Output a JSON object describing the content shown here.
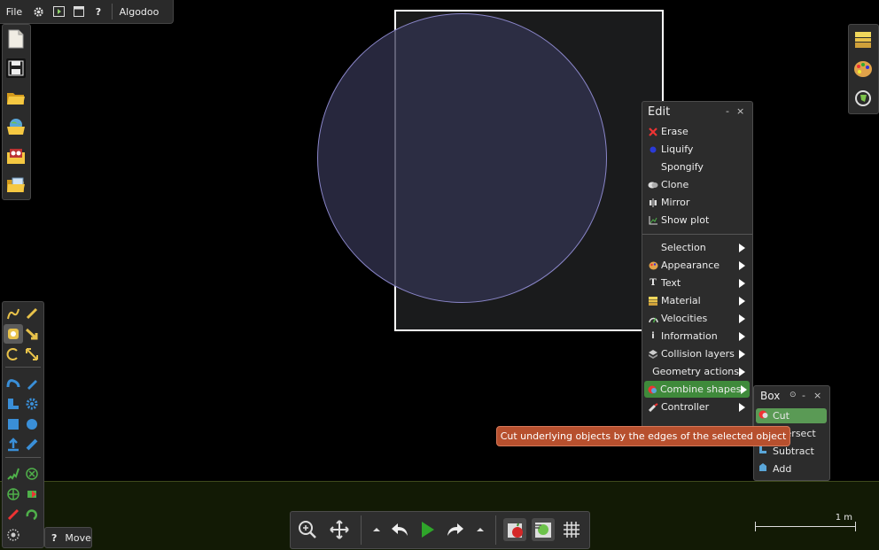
{
  "topbar": {
    "file_label": "File",
    "app_name": "Algodoo",
    "help_label": "?"
  },
  "left_file_panel": {
    "items": [
      "new-scene-icon",
      "save-icon",
      "open-folder-icon",
      "browse-online-icon",
      "load-scenes-icon",
      "open-phunlet-icon"
    ]
  },
  "right_panel": {
    "items": [
      "background-icon",
      "palette-icon",
      "tools-settings-icon"
    ]
  },
  "tools_panel": {
    "tools": [
      "sketch-tool",
      "cut-tool",
      "move-tool",
      "drag-tool",
      "rotate-tool",
      "scale-tool",
      "rope-tool",
      "pencil-tool",
      "plane-tool",
      "gear-tool",
      "box-tool",
      "circle-tool",
      "fixate-tool",
      "spring-tool",
      "chain-tool",
      "hinge-tool",
      "axle-tool",
      "tracer-tool",
      "laser-tool",
      "thruster-tool",
      "brush-tool"
    ]
  },
  "move_hint": {
    "help": "?",
    "label": "Move"
  },
  "edit_menu": {
    "title": "Edit",
    "minimize": "-",
    "close": "×",
    "actions": [
      "Erase",
      "Liquify",
      "Spongify",
      "Clone",
      "Mirror",
      "Show plot"
    ],
    "submenus": [
      "Selection",
      "Appearance",
      "Text",
      "Material",
      "Velocities",
      "Information",
      "Collision layers",
      "Geometry actions",
      "Combine shapes",
      "Controller"
    ],
    "highlighted": "Combine shapes"
  },
  "box_menu": {
    "title": "Box",
    "pin": "⊙",
    "minimize": "-",
    "close": "×",
    "items": [
      "Cut",
      "Intersect",
      "Subtract",
      "Add"
    ],
    "highlighted": "Cut"
  },
  "tooltip": {
    "text": "Cut underlying objects by the edges of the selected object"
  },
  "bottom_toolbar": {
    "buttons": [
      "zoom-icon",
      "pan-icon",
      "undo-dropdown-icon",
      "undo-icon",
      "play-icon",
      "redo-icon",
      "redo-dropdown-icon",
      "gravity-icon",
      "air-friction-icon",
      "grid-icon"
    ]
  },
  "scale": {
    "label": "1 m"
  },
  "colors": {
    "highlight": "#3f8a3b",
    "tooltip": "#b7502e",
    "circle_stroke": "#8a86c9",
    "ground": "#121a05"
  }
}
